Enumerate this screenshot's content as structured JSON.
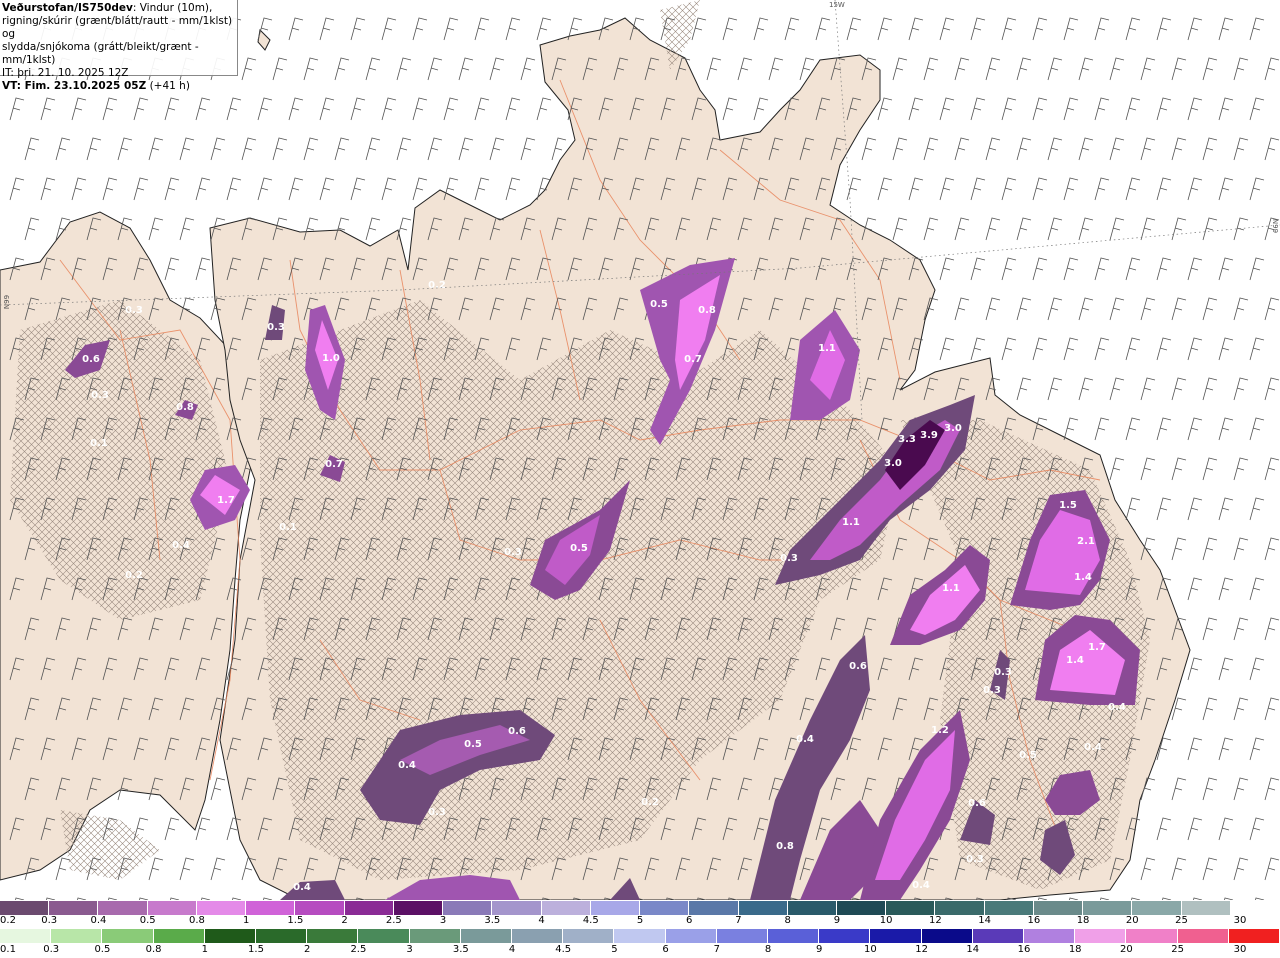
{
  "header": {
    "title_bold": "Veðurstofan/IS750dev",
    "title_rest": ": Vindur (10m),",
    "line2": "rigning/skúrir (grænt/blátt/rautt - mm/1klst) og",
    "line3": "slydda/snjókoma (grátt/bleikt/grænt - mm/1klst)",
    "line4": "IT: þri. 21. 10. 2025 12Z",
    "line5_bold": "VT: Fim. 23.10.2025 05Z",
    "line5_rest": "(+41 h)"
  },
  "grid_labels": {
    "top": "15W",
    "right": "N99",
    "left": "N99"
  },
  "colors": {
    "land": "#f2e3d5",
    "sea": "#ffffff",
    "roads": "#e8845a",
    "precip_light": "#6f4a7a",
    "precip_mid": "#c25bc9",
    "precip_high": "#f07ef0",
    "precip_peak": "#4a0a4f"
  },
  "precip_labels": [
    "0.3",
    "0.6",
    "0.3",
    "0.8",
    "0.1",
    "0.3",
    "1.0",
    "0.7",
    "1.7",
    "0.4",
    "0.2",
    "0.2",
    "0.5",
    "0.8",
    "0.7",
    "1.1",
    "3.3",
    "3.9",
    "3.0",
    "3.0",
    "1.1",
    "0.3",
    "0.5",
    "0.3",
    "1.1",
    "1.5",
    "2.1",
    "1.4",
    "1.7",
    "1.4",
    "0.6",
    "0.3",
    "0.3",
    "0.4",
    "1.2",
    "0.5",
    "0.6",
    "0.4",
    "0.8",
    "0.2",
    "0.4",
    "0.5",
    "0.4",
    "0.4",
    "0.3",
    "0.3",
    "0.6",
    "0.4",
    "0.1"
  ],
  "legend_snow": {
    "labels": [
      "0.2",
      "0.3",
      "0.4",
      "0.5",
      "0.8",
      "1",
      "1.5",
      "2",
      "2.5",
      "3",
      "3.5",
      "4",
      "4.5",
      "5",
      "6",
      "7",
      "8",
      "9",
      "10",
      "12",
      "14",
      "16",
      "18",
      "20",
      "25",
      "30"
    ],
    "colors": [
      "#6b4a6f",
      "#8a5a8f",
      "#a86aad",
      "#c77acc",
      "#e48ae8",
      "#d063d8",
      "#b64cc0",
      "#8a2b95",
      "#5b1065",
      "#8a7ab8",
      "#a495cc",
      "#bcb0dc",
      "#a8a8e8",
      "#7a88c8",
      "#5a78a8",
      "#3a6a8a",
      "#2a5a6a",
      "#1f4a55",
      "#2a5a5a",
      "#3a6a6a",
      "#4a7a7a",
      "#6a8a8a",
      "#7a9a9a",
      "#8aa8a8",
      "#b0c0c0",
      "#ffffff"
    ]
  },
  "legend_rain": {
    "labels": [
      "0.1",
      "0.3",
      "0.5",
      "0.8",
      "1",
      "1.5",
      "2",
      "2.5",
      "3",
      "3.5",
      "4",
      "4.5",
      "5",
      "6",
      "7",
      "8",
      "9",
      "10",
      "12",
      "14",
      "16",
      "18",
      "20",
      "25",
      "30"
    ],
    "colors": [
      "#e6f7e0",
      "#b8e6a8",
      "#8acb78",
      "#5aab4a",
      "#1f5a1a",
      "#2a6a2a",
      "#3a7a3a",
      "#4a8a5a",
      "#6a9a7a",
      "#7a9a9a",
      "#8aa0b0",
      "#a0b0c8",
      "#c0c8f0",
      "#9aa0e8",
      "#7a80e0",
      "#5a60d8",
      "#3a3ac8",
      "#1a1aa8",
      "#0a0a8a",
      "#5a3ab8",
      "#b080e0",
      "#f0a0e8",
      "#f080c8",
      "#f06090",
      "#f02020"
    ]
  }
}
